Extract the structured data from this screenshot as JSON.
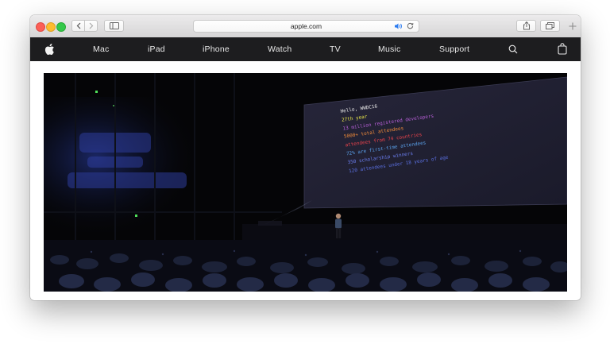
{
  "browser": {
    "url": "apple.com",
    "icons": {
      "back": "chevron-left-icon",
      "forward": "chevron-right-icon",
      "sidebar": "sidebar-icon",
      "audio": "speaker-icon",
      "reload": "reload-icon",
      "share": "share-icon",
      "tabs": "tabs-icon",
      "new_tab": "plus-icon"
    }
  },
  "nav": {
    "logo": "apple-logo-icon",
    "items": [
      "Mac",
      "iPad",
      "iPhone",
      "Watch",
      "TV",
      "Music",
      "Support"
    ],
    "search_icon": "search-icon",
    "bag_icon": "bag-icon"
  },
  "hero": {
    "screen_lines": [
      {
        "text": "Hello, WWDC16",
        "color": "#e8e8e8"
      },
      {
        "text": "27th year",
        "color": "#e9e64a"
      },
      {
        "text": "13 million registered developers",
        "color": "#b65fd6"
      },
      {
        "text": "5000+ total attendees",
        "color": "#ef8a3a"
      },
      {
        "text": "attendees from 74 countries",
        "color": "#e9434c"
      },
      {
        "text": "72% are first-time attendees",
        "color": "#5aa0ea"
      },
      {
        "text": "350 scholarship winners",
        "color": "#6b7ef0"
      },
      {
        "text": "120 attendees under 18 years of age",
        "color": "#5a6fe0"
      }
    ]
  },
  "colors": {
    "nav_bg": "#1d1d1f",
    "nav_text": "#e8e8e8",
    "toolbar_bg": "#dedede",
    "accent_blue": "#2b7bf0"
  }
}
